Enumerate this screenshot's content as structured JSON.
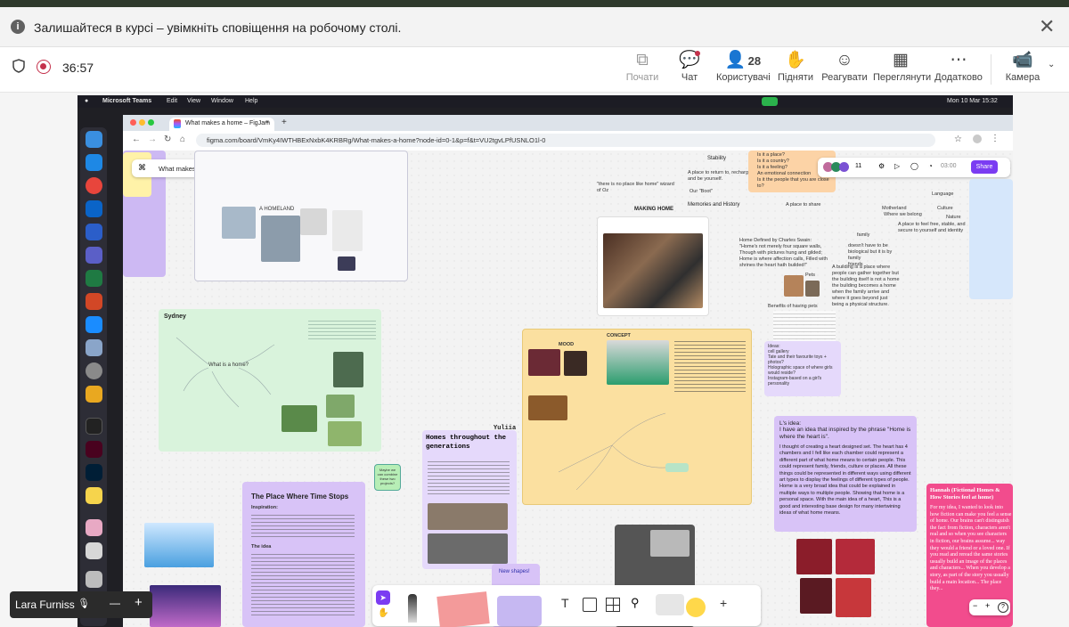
{
  "notification": {
    "text": "Залишайтеся в курсі – увімкніть сповіщення на робочому столі.",
    "close": "✕",
    "info": "i"
  },
  "meeting": {
    "timer": "36:57",
    "tools": [
      {
        "label": "Почати",
        "icon": "⧉"
      },
      {
        "label": "Чат",
        "icon": "💬"
      },
      {
        "label": "Користувачі",
        "icon": "👤",
        "count": "28"
      },
      {
        "label": "Підняти",
        "icon": "✋"
      },
      {
        "label": "Реагувати",
        "icon": "☺"
      },
      {
        "label": "Переглянути",
        "icon": "▦"
      },
      {
        "label": "Додатково",
        "icon": "⋯"
      },
      {
        "label": "Камера",
        "icon": "📹"
      }
    ]
  },
  "mac": {
    "app": "Microsoft Teams",
    "menus": [
      "Edit",
      "View",
      "Window",
      "Help"
    ],
    "clock": "Mon 10 Mar  15:32"
  },
  "browser": {
    "tab_title": "What makes a home – FigJam",
    "url": "figma.com/board/VmKy4IWTHBExNxbK4KRBRg/What-makes-a-home?node-id=0-1&p=f&t=VU2tgvLPfUSNLO1l-0"
  },
  "figjam": {
    "file_name": "What makes a home",
    "share": "Share",
    "timer": "03:00",
    "avatar_count": "11",
    "notes": {
      "a_homeland": "A HOMELAND",
      "making_home": "MAKING HOME",
      "stability": "Stability",
      "return_to": "A place to return to, recharge, and be yourself.",
      "our_boot": "Our \"Boot\"",
      "memories": "Memories and History",
      "place_to_share": "A place to share",
      "questions": [
        "Is it a place?",
        "Is it a country?",
        "Is it a feeling?",
        "An emotional connection",
        "Is it the people that you are close to?"
      ],
      "motherland": "Motherland",
      "where_belong": "Where we belong",
      "language": "Language",
      "culture": "Culture",
      "nature": "Nature",
      "family": "family",
      "sydney": "Sydney",
      "what_is_home": "What is a home?",
      "yuliia": "Yuliia",
      "homes_generations": "Homes throughout the generations",
      "maybe_overtime": "Maybe we can combine these two projects?",
      "place_time_stops": "The Place Where Time Stops",
      "inspiration": "Inspiration:",
      "the_idea": "The idea",
      "new_shapes": "New shapes!",
      "concept": "CONCEPT",
      "moodboard": "MOOD",
      "ls_idea_title": "L's idea:",
      "ls_idea": "I have an idea that inspired by the phrase \"Home is where the heart is\".",
      "ls_idea_body": "I thought of creating a heart designed set. The heart has 4 chambers and I fell like each chamber could represent a different part of what home means to certain people. This could represent family, friends, culture or places. All these things could be represented in different ways using different art types to display the feelings of different types of people. Home is a very broad idea that could be explained in multiple ways to multiple people. Showing that home is a personal space. With the main idea of a heart, This is a good and interesting base design for many intertwining ideas of what home means.",
      "hannah_title": "Hannah (Fictional Homes & How Stories feel at home)",
      "hannah_body": "For my idea, I wanted to look into how fiction can make you feel a sense of home. Our brains can't distinguish the fact from fiction, characters aren't real and so when you see characters in fiction, our brains assume... way they would a friend or a loved one. If you read and reread the same stories usually build an image of the places and characters... When you develop a story, as part of the story you usually build a main location... The place they...",
      "ideas_label": "Ideas:",
      "ideas": [
        "cell gallery",
        "Tate and their favourite toys + photos?",
        "Holographic space of where girls would reside?",
        "cells and their different lifestyles in Chicago, Ukraine and Birmingham, never split two ideas?",
        "Instagram-based on a girl's personality",
        "A drip is a menu held friend"
      ],
      "charles_quote": "Home Defined by Charles Swain: \"Home's not merely four square walls, Though with pictures hung and gilded; Home is where affection calls, Filled with shrines the heart hath builded!\"",
      "belonging": "A building is a place where people can gather together but the building itself is not a home the building becomes a home when the family arrive and where it goes beyond just being a physical structure.",
      "benefits": "Benefits of having pets",
      "pets": "Pets",
      "doesnt_have": "doesn't have to be biological but it is by family",
      "place_feel_free": "A place to feel free, stable, and secure to yourself and identity",
      "friends": "friends",
      "there_is_no_place": "\"there is no place like home\" wizard of Oz"
    }
  },
  "self_view": {
    "name": "Lara Furniss",
    "mic_off": "🎙",
    "minus": "—",
    "plus": "+"
  }
}
